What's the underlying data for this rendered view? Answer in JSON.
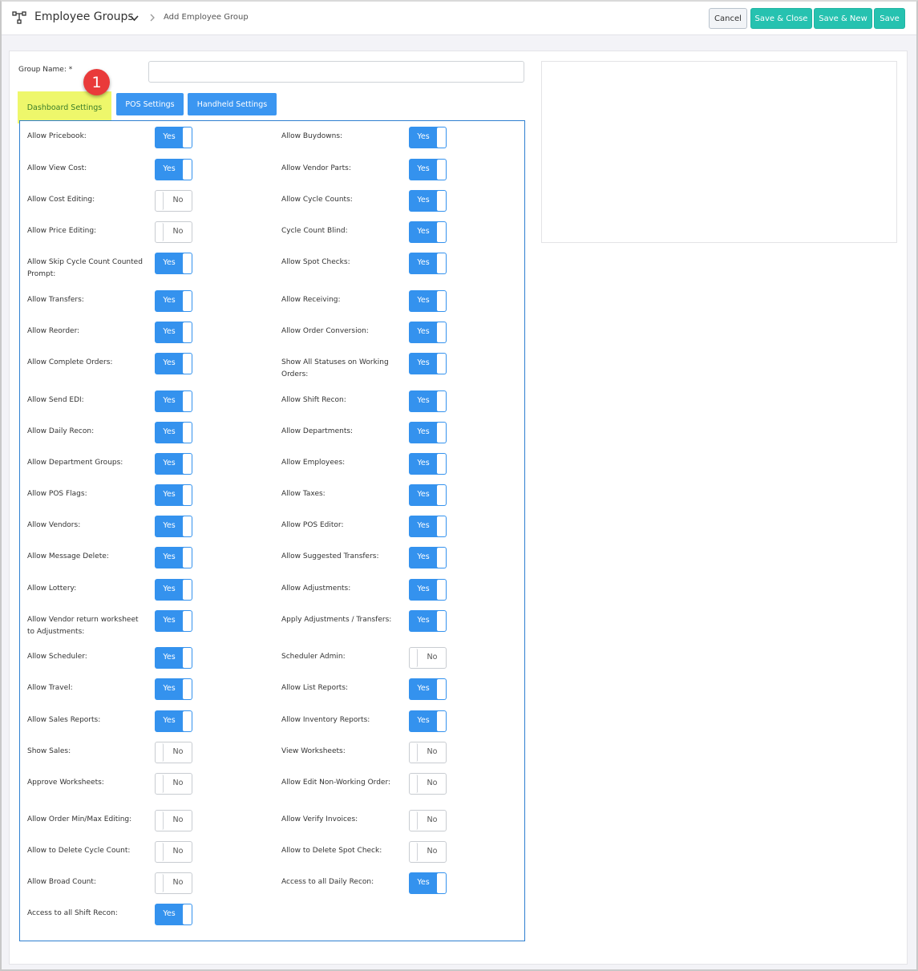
{
  "header": {
    "title": "Employee Groups",
    "breadcrumb": "Add Employee Group",
    "buttons": {
      "cancel": "Cancel",
      "save_close": "Save & Close",
      "save_new": "Save & New",
      "save": "Save"
    }
  },
  "form": {
    "group_name_label": "Group Name: *",
    "group_name_value": ""
  },
  "tabs": [
    {
      "label": "Dashboard Settings",
      "active": true
    },
    {
      "label": "POS Settings",
      "active": false
    },
    {
      "label": "Handheld Settings",
      "active": false
    }
  ],
  "annotation_badge": "1",
  "colors": {
    "accent_blue": "#3492ee",
    "teal": "#26c2b0",
    "highlight": "#eef76b",
    "badge_red": "#e93a3a"
  },
  "settings": {
    "left": [
      {
        "label": "Allow Pricebook:",
        "value": "Yes"
      },
      {
        "label": "Allow View Cost:",
        "value": "Yes"
      },
      {
        "label": "Allow Cost Editing:",
        "value": "No"
      },
      {
        "label": "Allow Price Editing:",
        "value": "No"
      },
      {
        "label": "Allow Skip Cycle Count Counted Prompt:",
        "value": "Yes"
      },
      {
        "label": "Allow Transfers:",
        "value": "Yes"
      },
      {
        "label": "Allow Reorder:",
        "value": "Yes"
      },
      {
        "label": "Allow Complete Orders:",
        "value": "Yes"
      },
      {
        "label": "Allow Send EDI:",
        "value": "Yes"
      },
      {
        "label": "Allow Daily Recon:",
        "value": "Yes"
      },
      {
        "label": "Allow Department Groups:",
        "value": "Yes"
      },
      {
        "label": "Allow POS Flags:",
        "value": "Yes"
      },
      {
        "label": "Allow Vendors:",
        "value": "Yes"
      },
      {
        "label": "Allow Message Delete:",
        "value": "Yes"
      },
      {
        "label": "Allow Lottery:",
        "value": "Yes"
      },
      {
        "label": "Allow Vendor return worksheet to Adjustments:",
        "value": "Yes"
      },
      {
        "label": "Allow Scheduler:",
        "value": "Yes"
      },
      {
        "label": "Allow Travel:",
        "value": "Yes"
      },
      {
        "label": "Allow Sales Reports:",
        "value": "Yes"
      },
      {
        "label": "Show Sales:",
        "value": "No"
      },
      {
        "label": "Approve Worksheets:",
        "value": "No"
      },
      {
        "label": "Allow Order Min/Max Editing:",
        "value": "No"
      },
      {
        "label": "Allow to Delete Cycle Count:",
        "value": "No"
      },
      {
        "label": "Allow Broad Count:",
        "value": "No"
      },
      {
        "label": "Access to all Shift Recon:",
        "value": "Yes"
      }
    ],
    "right": [
      {
        "label": "Allow Buydowns:",
        "value": "Yes"
      },
      {
        "label": "Allow Vendor Parts:",
        "value": "Yes"
      },
      {
        "label": "Allow Cycle Counts:",
        "value": "Yes"
      },
      {
        "label": "Cycle Count Blind:",
        "value": "Yes"
      },
      {
        "label": "Allow Spot Checks:",
        "value": "Yes"
      },
      {
        "label": "Allow Receiving:",
        "value": "Yes"
      },
      {
        "label": "Allow Order Conversion:",
        "value": "Yes"
      },
      {
        "label": "Show All Statuses on Working Orders:",
        "value": "Yes"
      },
      {
        "label": "Allow Shift Recon:",
        "value": "Yes"
      },
      {
        "label": "Allow Departments:",
        "value": "Yes"
      },
      {
        "label": "Allow Employees:",
        "value": "Yes"
      },
      {
        "label": "Allow Taxes:",
        "value": "Yes"
      },
      {
        "label": "Allow POS Editor:",
        "value": "Yes"
      },
      {
        "label": "Allow Suggested Transfers:",
        "value": "Yes"
      },
      {
        "label": "Allow Adjustments:",
        "value": "Yes"
      },
      {
        "label": "Apply Adjustments / Transfers:",
        "value": "Yes"
      },
      {
        "label": "Scheduler Admin:",
        "value": "No"
      },
      {
        "label": "Allow List Reports:",
        "value": "Yes"
      },
      {
        "label": "Allow Inventory Reports:",
        "value": "Yes"
      },
      {
        "label": "View Worksheets:",
        "value": "No"
      },
      {
        "label": "Allow Edit Non-Working Order:",
        "value": "No"
      },
      {
        "label": "Allow Verify Invoices:",
        "value": "No"
      },
      {
        "label": "Allow to Delete Spot Check:",
        "value": "No"
      },
      {
        "label": "Access to all Daily Recon:",
        "value": "Yes"
      }
    ]
  }
}
